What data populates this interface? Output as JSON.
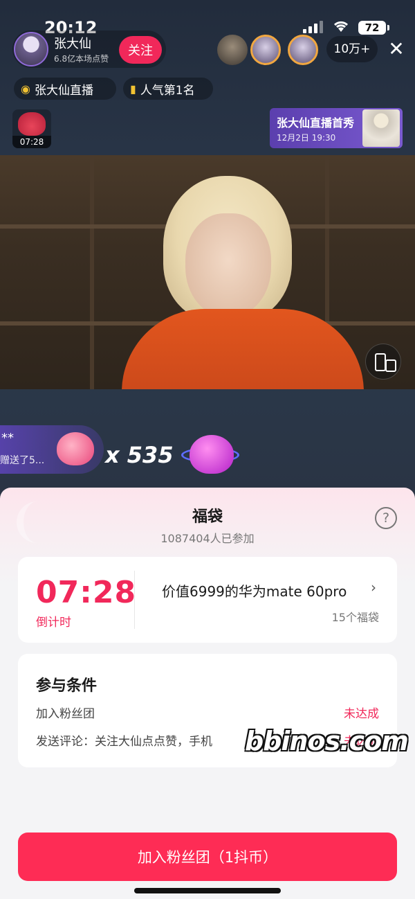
{
  "status_bar": {
    "time": "20:12",
    "battery": "72"
  },
  "host": {
    "name": "张大仙",
    "likes": "6.8亿本场点赞",
    "follow_label": "关注"
  },
  "viewers": {
    "count": "10万+"
  },
  "tags": [
    {
      "label": "张大仙直播"
    },
    {
      "label": "人气第1名"
    }
  ],
  "lucky_bag_thumb": {
    "timer": "07:28"
  },
  "premiere": {
    "title": "张大仙直播首秀",
    "date": "12月2日 19:30"
  },
  "gift": {
    "sender": "**",
    "action": "赠送了5...",
    "combo": "x 535"
  },
  "sheet": {
    "title": "福袋",
    "participants": "1087404人已参加",
    "countdown": "07:28",
    "countdown_label": "倒计时",
    "prize_name": "价值6999的华为mate 60pro",
    "prize_count": "15个福袋",
    "conditions_title": "参与条件",
    "conditions": [
      {
        "label": "加入粉丝团",
        "status": "未达成"
      },
      {
        "label": "发送评论：关注大仙点点赞，手机",
        "status": "未达成"
      }
    ],
    "join_label": "加入粉丝团（1抖币）"
  },
  "watermark": "bbinos.com",
  "colors": {
    "accent": "#fe2c55",
    "countdown": "#f1285a",
    "premiere": "#5b3fae"
  },
  "icons": [
    "wifi-icon",
    "signal-icon",
    "battery-icon",
    "close-icon",
    "flame-icon",
    "bar-chart-icon",
    "lucky-bag-icon",
    "help-icon",
    "chevron-right-icon",
    "rotate-screen-icon",
    "heart-gift-icon"
  ]
}
